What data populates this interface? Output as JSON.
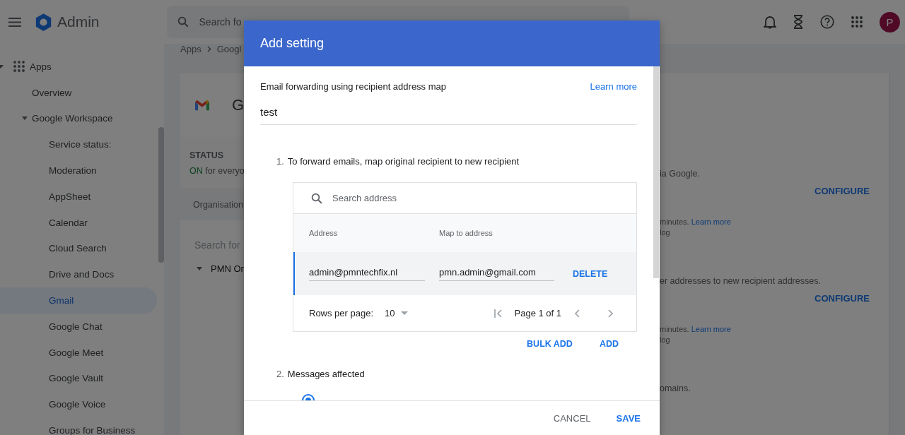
{
  "topbar": {
    "title": "Admin",
    "search_placeholder": "Search fo",
    "avatar": "P"
  },
  "breadcrumb": [
    "Apps",
    "Googl"
  ],
  "sidebar": {
    "items": [
      {
        "label": "Apps",
        "expanded": true,
        "selected": false,
        "children": [
          {
            "label": "Overview",
            "selected": false
          },
          {
            "label": "Google Workspace",
            "expanded": true,
            "selected": false,
            "children": [
              {
                "label": "Service status:",
                "selected": false
              },
              {
                "label": "Moderation",
                "selected": false
              },
              {
                "label": "AppSheet",
                "selected": false
              },
              {
                "label": "Calendar",
                "selected": false
              },
              {
                "label": "Cloud Search",
                "selected": false
              },
              {
                "label": "Drive and Docs",
                "selected": false
              },
              {
                "label": "Gmail",
                "selected": true
              },
              {
                "label": "Google Chat",
                "selected": false
              },
              {
                "label": "Google Meet",
                "selected": false
              },
              {
                "label": "Google Vault",
                "selected": false
              },
              {
                "label": "Google Voice",
                "selected": false
              },
              {
                "label": "Groups for Business",
                "selected": false
              }
            ]
          }
        ]
      }
    ]
  },
  "app_card": {
    "title": "G",
    "status_label": "STATUS",
    "status_on": "ON",
    "status_rest": "for everyo",
    "org_tab": "Organisation",
    "org_search_placeholder": "Search for",
    "org_unit": "PMN Or",
    "sections": [
      {
        "description": "ia Google.",
        "action": "CONFIGURE",
        "note": "minutes.",
        "note_link": "Learn more",
        "note_2": "log"
      },
      {
        "description": "er addresses to new recipient addresses.",
        "action": "CONFIGURE",
        "note": "minutes.",
        "note_link": "Learn more",
        "note_2": "log"
      },
      {
        "description": "omains."
      }
    ]
  },
  "dialog": {
    "title": "Add setting",
    "setting_name": "Email forwarding using recipient address map",
    "learn_more": "Learn more",
    "name_value": "test",
    "step1": {
      "number": "1.",
      "text": "To forward emails, map original recipient to new recipient"
    },
    "table": {
      "search_placeholder": "Search address",
      "columns": [
        "Address",
        "Map to address"
      ],
      "rows": [
        {
          "address": "admin@pmntechfix.nl",
          "map_to": "pmn.admin@gmail.com",
          "action": "DELETE",
          "selected": true
        }
      ],
      "pagination": {
        "rows_label": "Rows per page:",
        "rows_value": "10",
        "page_label": "Page 1 of 1"
      }
    },
    "actions": [
      "BULK ADD",
      "ADD"
    ],
    "step2": {
      "number": "2.",
      "text": "Messages affected"
    },
    "footer": [
      {
        "label": "CANCEL",
        "kind": "secondary"
      },
      {
        "label": "SAVE",
        "kind": "primary"
      }
    ]
  }
}
